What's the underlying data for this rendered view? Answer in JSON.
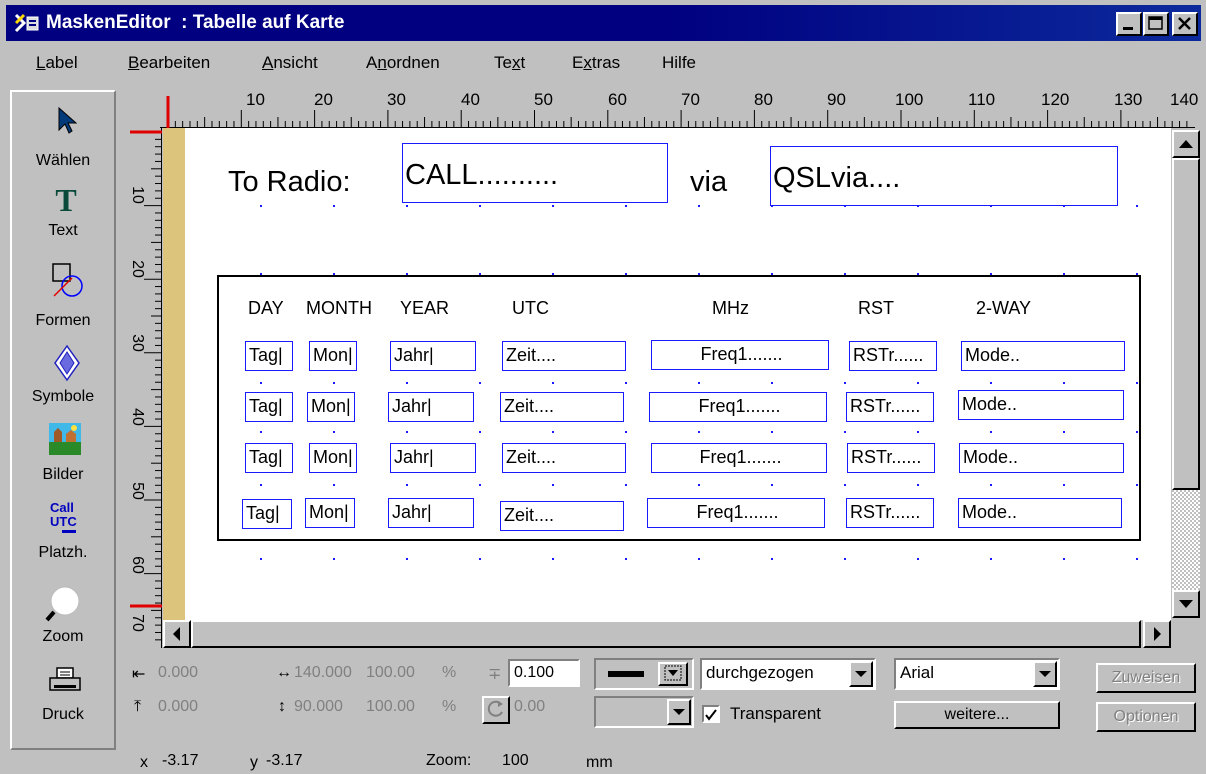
{
  "window": {
    "title": "MaskenEditor  : Tabelle auf Karte",
    "buttons": [
      "minimize",
      "maximize",
      "close"
    ]
  },
  "menu": [
    {
      "label": "Label",
      "accel": "L"
    },
    {
      "label": "Bearbeiten",
      "accel": "B"
    },
    {
      "label": "Ansicht",
      "accel": "A"
    },
    {
      "label": "Anordnen",
      "accel": "n"
    },
    {
      "label": "Text",
      "accel": "x"
    },
    {
      "label": "Extras",
      "accel": "t"
    },
    {
      "label": "Hilfe",
      "accel": ""
    }
  ],
  "toolbox": {
    "select": "Wählen",
    "text": "Text",
    "shapes": "Formen",
    "symbols": "Symbole",
    "images": "Bilder",
    "placeholders": "Platzh.",
    "placeholder_icon_top": "Call",
    "placeholder_icon_bottom": "UTC",
    "zoom": "Zoom",
    "print": "Druck"
  },
  "ruler": {
    "h_labels": [
      "10",
      "20",
      "30",
      "40",
      "50",
      "60",
      "70",
      "80",
      "90",
      "100",
      "110",
      "120",
      "130",
      "140"
    ],
    "v_labels": [
      "10",
      "20",
      "30",
      "40",
      "50",
      "60",
      "70"
    ]
  },
  "canvas": {
    "to_radio_label": "To Radio:",
    "call_field": "CALL..........",
    "via_label": "via",
    "qslvia_field": "QSLvia....",
    "headers": [
      "DAY",
      "MONTH",
      "YEAR",
      "UTC",
      "MHz",
      "RST",
      "2-WAY"
    ],
    "row_fields": [
      "Tag|",
      "Mon|",
      "Jahr|",
      "Zeit....",
      "Freq1.......",
      "RSTr......",
      "Mode.."
    ]
  },
  "properties": {
    "x": "0.000",
    "width": "140.000",
    "width_pct": "100.00",
    "line_width": "0.100",
    "y": "0.000",
    "height": "90.000",
    "height_pct": "100.00",
    "rotation": "0.00",
    "pct_symbol": "%",
    "line_style": "durchgezogen",
    "transparent_label": "Transparent",
    "transparent_checked": true,
    "font": "Arial",
    "more_button": "weitere...",
    "assign_button": "Zuweisen",
    "options_button": "Optionen"
  },
  "status": {
    "x_label": "x",
    "x_value": "-3.17",
    "y_label": "y",
    "y_value": "-3.17",
    "zoom_label": "Zoom:",
    "zoom_value": "100",
    "unit": "mm"
  },
  "colors": {
    "title_bar": "#000080",
    "field_border": "#1a1aff",
    "margin_bar": "#dcc47c",
    "ruler_marker": "#e00000"
  }
}
